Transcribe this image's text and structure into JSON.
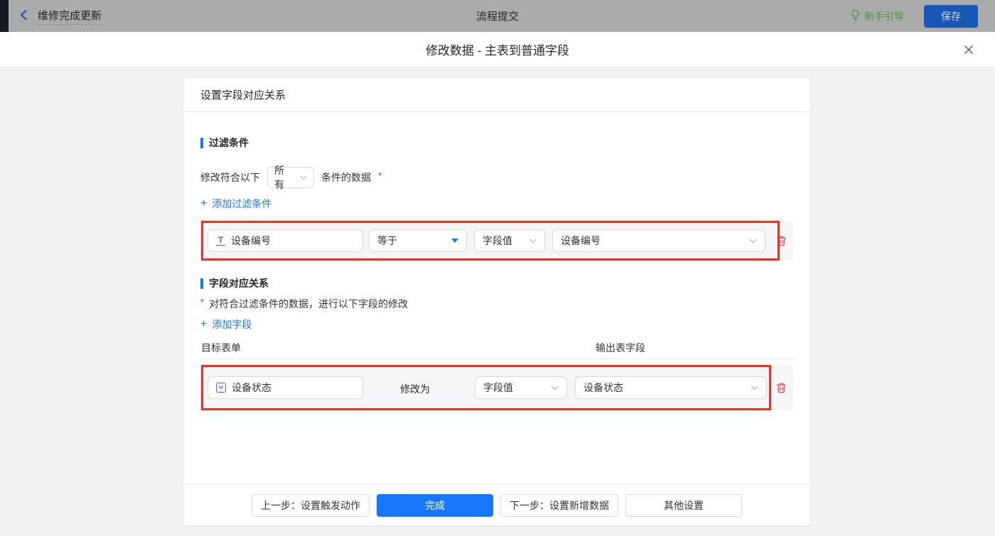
{
  "colors": {
    "accent_blue": "#1677ff",
    "annotation_red": "#f23022",
    "trash_red": "#f5434c",
    "guide_green": "#3f9a44",
    "topbar_dimmed_bg": "#ababab",
    "modal_body_bg": "#f2f3f5"
  },
  "topbar": {
    "back_title": "维修完成更新",
    "center_title": "流程提交",
    "guide_label": "新手引导",
    "save_label": "保存"
  },
  "modal": {
    "title": "修改数据 - 主表到普通字段"
  },
  "card": {
    "header": "设置字段对应关系",
    "filter": {
      "section_title": "过滤条件",
      "cond_prefix": "修改符合以下",
      "cond_select_value": "所有",
      "cond_suffix": "条件的数据",
      "required_mark": "*",
      "add_plus": "+",
      "add_text": "添加过滤条件",
      "row": {
        "field": "设备编号",
        "operator": "等于",
        "value_type": "字段值",
        "value_field": "设备编号"
      }
    },
    "mapping": {
      "section_title": "字段对应关系",
      "required_mark": "*",
      "note": "对符合过滤条件的数据，进行以下字段的修改",
      "add_plus": "+",
      "add_text": "添加字段",
      "col_target": "目标表单",
      "col_output": "输出表字段",
      "row": {
        "field": "设备状态",
        "middle_label": "修改为",
        "value_type": "字段值",
        "value_field": "设备状态"
      }
    },
    "footer": {
      "prev_label": "上一步：设置触发动作",
      "done_label": "完成",
      "next_label": "下一步：设置新增数据",
      "other_label": "其他设置"
    }
  }
}
